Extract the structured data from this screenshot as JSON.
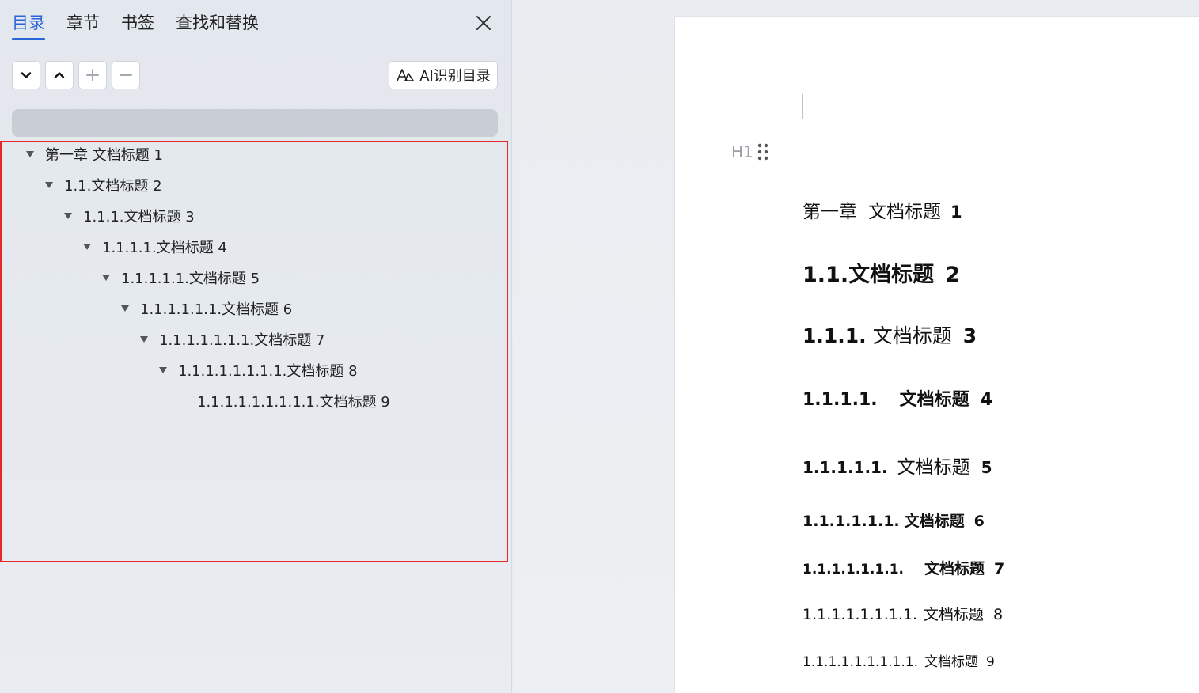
{
  "sidebar": {
    "tabs": [
      {
        "label": "目录",
        "active": true
      },
      {
        "label": "章节",
        "active": false
      },
      {
        "label": "书签",
        "active": false
      },
      {
        "label": "查找和替换",
        "active": false
      }
    ],
    "ai_button_label": "AI识别目录",
    "search_placeholder": "",
    "toc": [
      {
        "text": "第一章  文档标题  1",
        "level": 1,
        "expanded": true
      },
      {
        "text": "1.1.文档标题  2",
        "level": 2,
        "expanded": true
      },
      {
        "text": "1.1.1.文档标题  3",
        "level": 3,
        "expanded": true
      },
      {
        "text": "1.1.1.1.文档标题  4",
        "level": 4,
        "expanded": true
      },
      {
        "text": "1.1.1.1.1.文档标题  5",
        "level": 5,
        "expanded": true
      },
      {
        "text": "1.1.1.1.1.1.文档标题  6",
        "level": 6,
        "expanded": true
      },
      {
        "text": "1.1.1.1.1.1.1.文档标题  7",
        "level": 7,
        "expanded": true
      },
      {
        "text": "1.1.1.1.1.1.1.1.文档标题  8",
        "level": 8,
        "expanded": true
      },
      {
        "text": "1.1.1.1.1.1.1.1.1.文档标题  9",
        "level": 9,
        "expanded": false
      }
    ],
    "colors": {
      "accent": "#2a64d6",
      "highlight_border": "#e8272a"
    }
  },
  "document": {
    "heading_indicator": "H1",
    "headings": [
      {
        "number": "第一章",
        "title": "文档标题",
        "page": "1"
      },
      {
        "number": "1.1.",
        "title": "文档标题",
        "page": "2"
      },
      {
        "number": "1.1.1.",
        "title": "文档标题",
        "page": "3"
      },
      {
        "number": "1.1.1.1.",
        "title": "文档标题",
        "page": "4"
      },
      {
        "number": "1.1.1.1.1.",
        "title": "文档标题",
        "page": "5"
      },
      {
        "number": "1.1.1.1.1.1.",
        "title": "文档标题",
        "page": "6"
      },
      {
        "number": "1.1.1.1.1.1.1.",
        "title": "文档标题",
        "page": "7"
      },
      {
        "number": "1.1.1.1.1.1.1.1.",
        "title": "文档标题",
        "page": "8"
      },
      {
        "number": "1.1.1.1.1.1.1.1.1.",
        "title": "文档标题",
        "page": "9"
      }
    ]
  }
}
